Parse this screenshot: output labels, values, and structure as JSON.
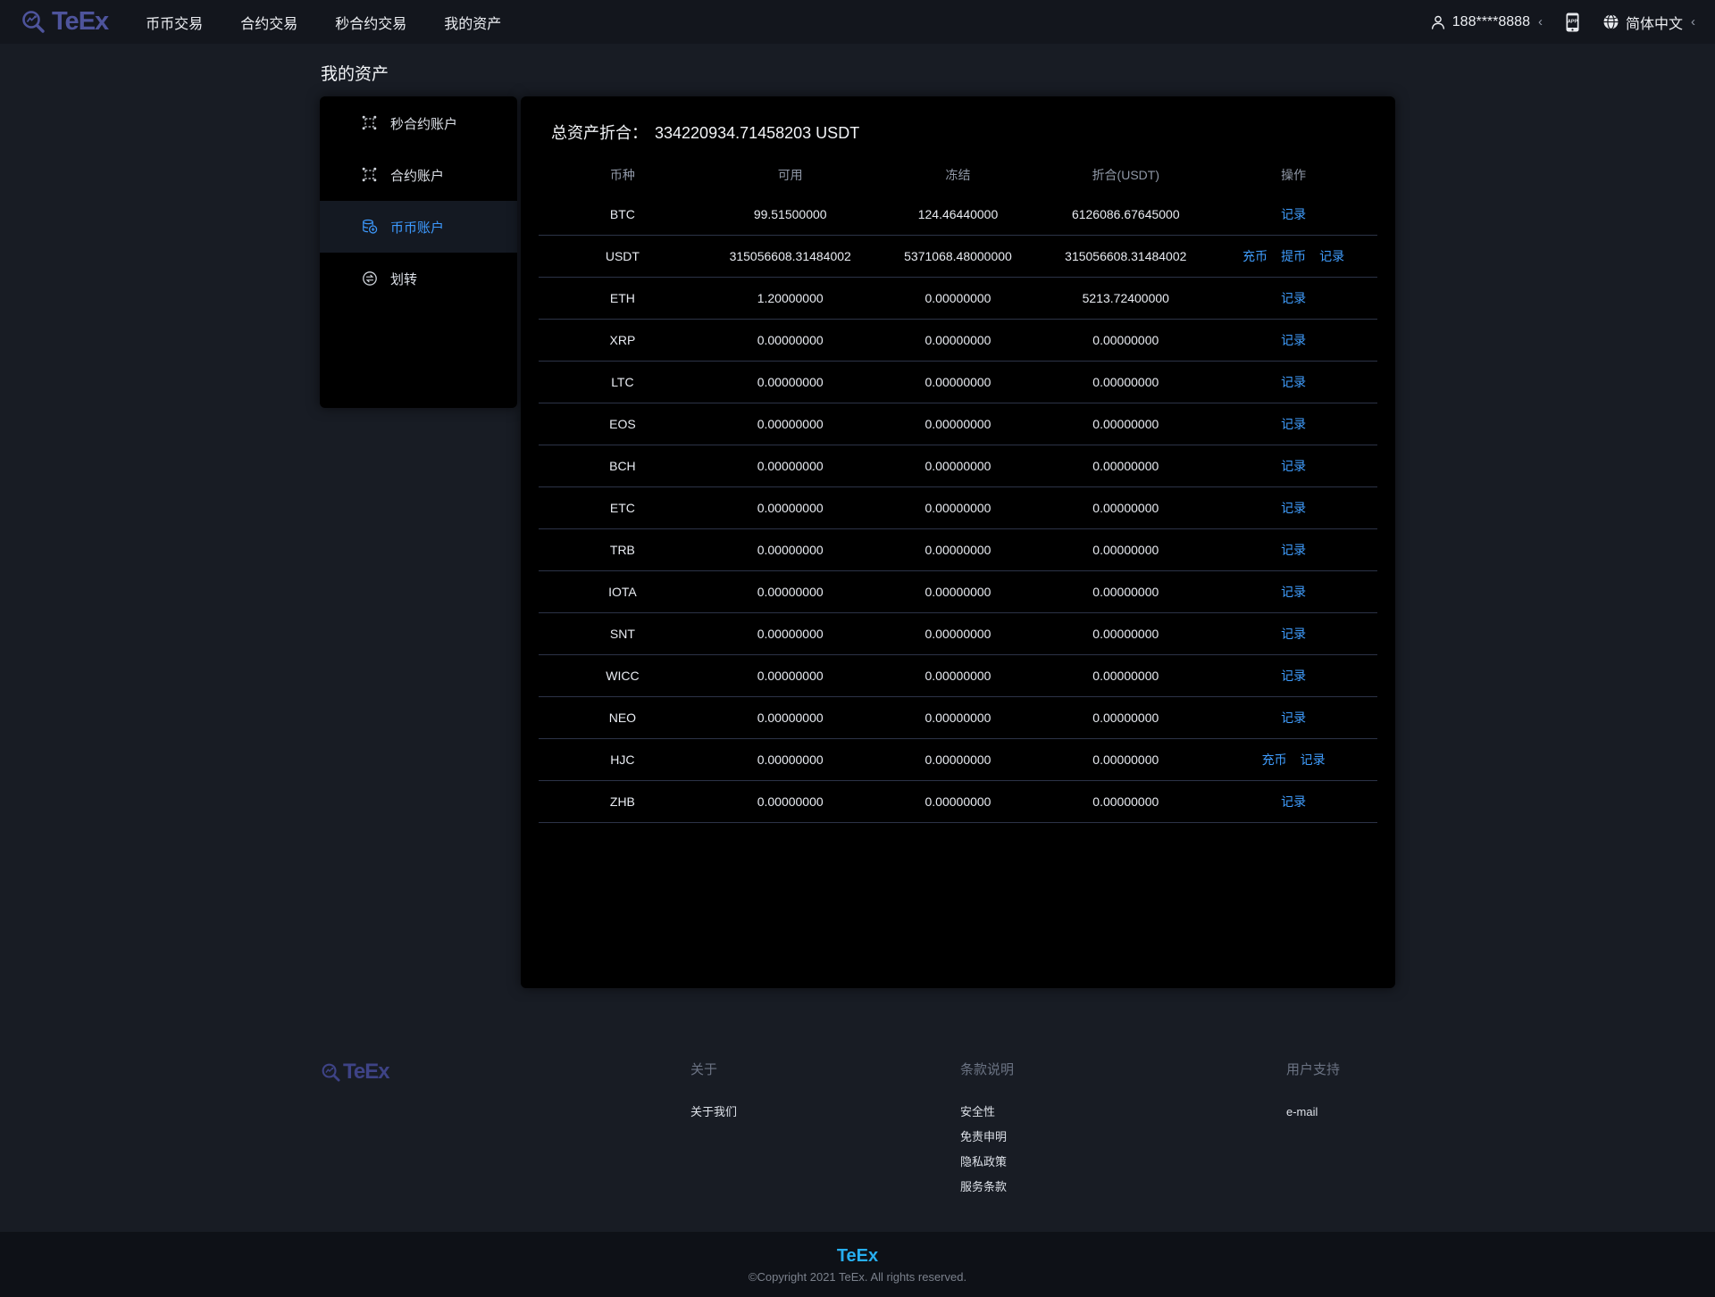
{
  "navbar": {
    "logo_text": "TeEx",
    "items": [
      {
        "label": "币币交易"
      },
      {
        "label": "合约交易"
      },
      {
        "label": "秒合约交易"
      },
      {
        "label": "我的资产"
      }
    ],
    "user": {
      "icon": "user-icon",
      "phone": "188****8888",
      "chevron": "‹"
    },
    "app_icon": {
      "icon": "app-download-icon",
      "label": "APP"
    },
    "language": {
      "icon": "globe-icon",
      "label": "简体中文",
      "chevron": "‹"
    }
  },
  "page": {
    "title": "我的资产"
  },
  "sidebar": {
    "items": [
      {
        "label": "秒合约账户",
        "icon": "contract-icon",
        "active": false
      },
      {
        "label": "合约账户",
        "icon": "contract-icon",
        "active": false
      },
      {
        "label": "币币账户",
        "icon": "coins-icon",
        "active": true
      },
      {
        "label": "划转",
        "icon": "transfer-icon",
        "active": false
      }
    ]
  },
  "assets": {
    "total_label": "总资产折合：",
    "total_value": "334220934.71458203 USDT",
    "table": {
      "headers": [
        "币种",
        "可用",
        "冻结",
        "折合(USDT)",
        "操作"
      ],
      "action_labels": {
        "deposit": "充币",
        "withdraw": "提币",
        "records": "记录"
      },
      "rows": [
        {
          "coin": "BTC",
          "available": "99.51500000",
          "frozen": "124.46440000",
          "converted": "6126086.67645000",
          "actions": [
            "records"
          ]
        },
        {
          "coin": "USDT",
          "available": "315056608.31484002",
          "frozen": "5371068.48000000",
          "converted": "315056608.31484002",
          "actions": [
            "deposit",
            "withdraw",
            "records"
          ]
        },
        {
          "coin": "ETH",
          "available": "1.20000000",
          "frozen": "0.00000000",
          "converted": "5213.72400000",
          "actions": [
            "records"
          ]
        },
        {
          "coin": "XRP",
          "available": "0.00000000",
          "frozen": "0.00000000",
          "converted": "0.00000000",
          "actions": [
            "records"
          ]
        },
        {
          "coin": "LTC",
          "available": "0.00000000",
          "frozen": "0.00000000",
          "converted": "0.00000000",
          "actions": [
            "records"
          ]
        },
        {
          "coin": "EOS",
          "available": "0.00000000",
          "frozen": "0.00000000",
          "converted": "0.00000000",
          "actions": [
            "records"
          ]
        },
        {
          "coin": "BCH",
          "available": "0.00000000",
          "frozen": "0.00000000",
          "converted": "0.00000000",
          "actions": [
            "records"
          ]
        },
        {
          "coin": "ETC",
          "available": "0.00000000",
          "frozen": "0.00000000",
          "converted": "0.00000000",
          "actions": [
            "records"
          ]
        },
        {
          "coin": "TRB",
          "available": "0.00000000",
          "frozen": "0.00000000",
          "converted": "0.00000000",
          "actions": [
            "records"
          ]
        },
        {
          "coin": "IOTA",
          "available": "0.00000000",
          "frozen": "0.00000000",
          "converted": "0.00000000",
          "actions": [
            "records"
          ]
        },
        {
          "coin": "SNT",
          "available": "0.00000000",
          "frozen": "0.00000000",
          "converted": "0.00000000",
          "actions": [
            "records"
          ]
        },
        {
          "coin": "WICC",
          "available": "0.00000000",
          "frozen": "0.00000000",
          "converted": "0.00000000",
          "actions": [
            "records"
          ]
        },
        {
          "coin": "NEO",
          "available": "0.00000000",
          "frozen": "0.00000000",
          "converted": "0.00000000",
          "actions": [
            "records"
          ]
        },
        {
          "coin": "HJC",
          "available": "0.00000000",
          "frozen": "0.00000000",
          "converted": "0.00000000",
          "actions": [
            "deposit",
            "records"
          ]
        },
        {
          "coin": "ZHB",
          "available": "0.00000000",
          "frozen": "0.00000000",
          "converted": "0.00000000",
          "actions": [
            "records"
          ]
        }
      ]
    }
  },
  "footer": {
    "logo_text": "TeEx",
    "columns": [
      {
        "title": "关于",
        "links": [
          "关于我们"
        ]
      },
      {
        "title": "条款说明",
        "links": [
          "安全性",
          "免责申明",
          "隐私政策",
          "服务条款"
        ]
      },
      {
        "title": "用户支持",
        "links": [
          "e-mail"
        ]
      }
    ],
    "brand": "TeEx",
    "copyright": "©Copyright 2021 TeEx. All rights reserved."
  },
  "colors": {
    "accent_blue": "#409eff",
    "active_item": "#3d9aff",
    "logo_purple": "#4e549c",
    "brand_cyan": "#27aef0",
    "panel_bg": "#000000",
    "page_bg": "#181c24"
  }
}
